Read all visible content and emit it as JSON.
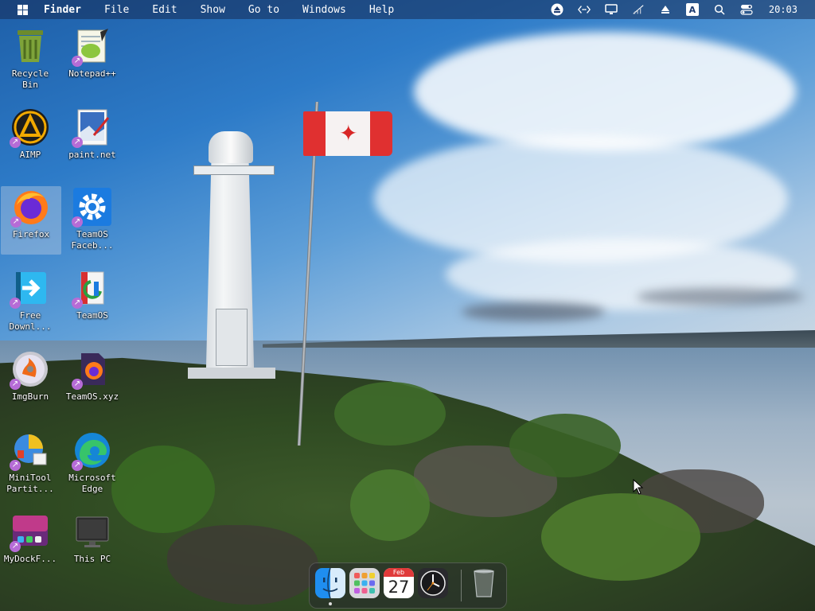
{
  "menubar": {
    "app_name": "Finder",
    "menus": [
      "File",
      "Edit",
      "Show",
      "Go to",
      "Windows",
      "Help"
    ],
    "tray_icons": [
      "eject-icon",
      "code-icon",
      "display-icon",
      "network-icon",
      "upload-icon",
      "input-method-icon",
      "search-icon",
      "control-center-icon"
    ],
    "input_method_label": "A",
    "clock": "20:03"
  },
  "desktop_icons": [
    {
      "label": "Recycle\nBin",
      "icon": "recycle-bin-icon",
      "shortcut": false
    },
    {
      "label": "Notepad++",
      "icon": "notepadpp-icon",
      "shortcut": true
    },
    {
      "label": "AIMP",
      "icon": "aimp-icon",
      "shortcut": true
    },
    {
      "label": "paint.net",
      "icon": "paintnet-icon",
      "shortcut": true
    },
    {
      "label": "Firefox",
      "icon": "firefox-icon",
      "shortcut": true,
      "selected": true
    },
    {
      "label": "TeamOS\nFaceb...",
      "icon": "gear-icon",
      "shortcut": true
    },
    {
      "label": "Free\nDownl...",
      "icon": "free-download-icon",
      "shortcut": true
    },
    {
      "label": "TeamOS",
      "icon": "teamos-icon",
      "shortcut": true
    },
    {
      "label": "ImgBurn",
      "icon": "imgburn-icon",
      "shortcut": true
    },
    {
      "label": "TeamOS.xyz",
      "icon": "teamos-xyz-icon",
      "shortcut": true
    },
    {
      "label": "MiniTool\nPartit...",
      "icon": "minitool-icon",
      "shortcut": true
    },
    {
      "label": "Microsoft\nEdge",
      "icon": "edge-icon",
      "shortcut": true
    },
    {
      "label": "MyDockF...",
      "icon": "mydock-icon",
      "shortcut": true
    },
    {
      "label": "This PC",
      "icon": "monitor-icon",
      "shortcut": false
    }
  ],
  "dock": {
    "items": [
      "finder-icon",
      "launchpad-icon",
      "calendar-icon",
      "clock-icon",
      "trash-icon"
    ],
    "calendar_month": "Feb",
    "calendar_day": "27"
  },
  "colors": {
    "menubar_bg": "#162c56",
    "shortcut_badge": "#b66cd6",
    "selection": "#b4c8e1"
  }
}
